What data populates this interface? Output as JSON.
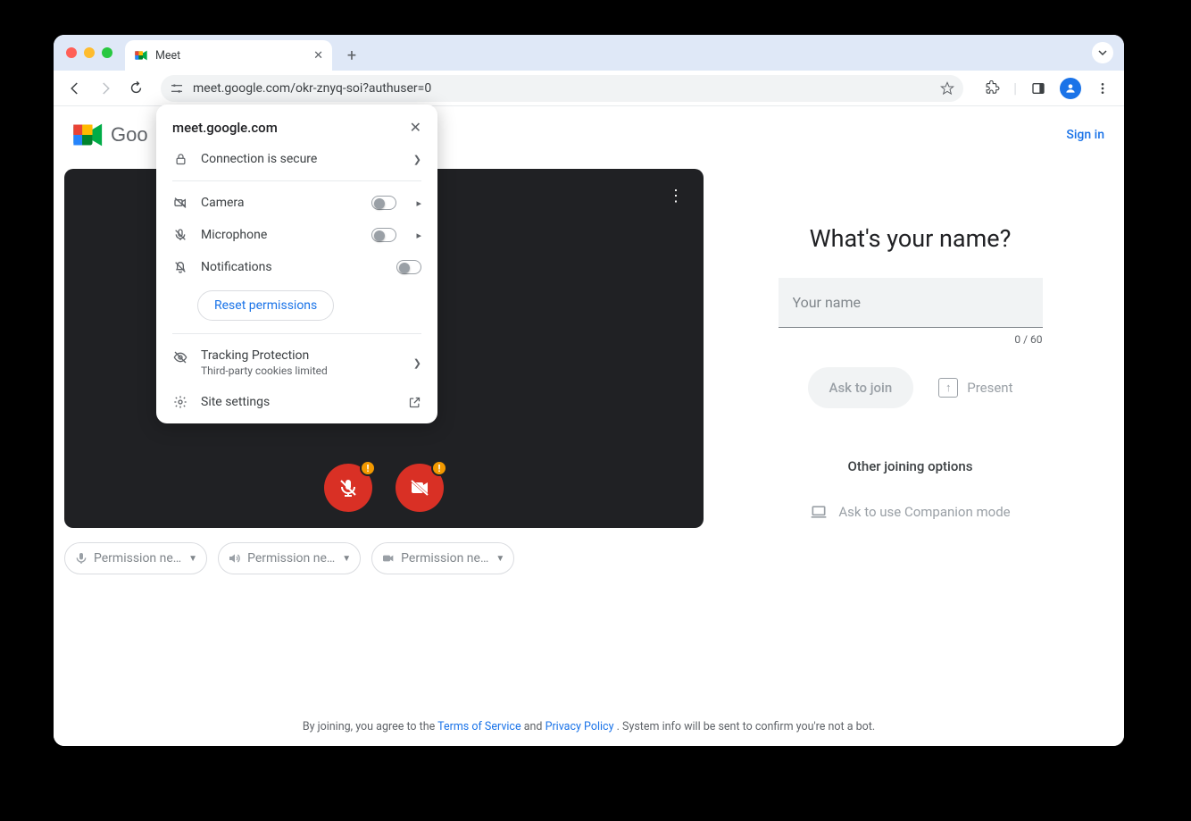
{
  "browser": {
    "tab_title": "Meet",
    "url": "meet.google.com/okr-znyq-soi?authuser=0"
  },
  "header": {
    "product": "Google Meet",
    "product_visible_prefix": "Goo",
    "signin": "Sign in"
  },
  "popover": {
    "site": "meet.google.com",
    "connection": "Connection is secure",
    "camera": "Camera",
    "microphone": "Microphone",
    "notifications": "Notifications",
    "reset": "Reset permissions",
    "tracking_title": "Tracking Protection",
    "tracking_sub": "Third-party cookies limited",
    "site_settings": "Site settings"
  },
  "preview": {
    "perm_chip_label": "Permission ne…"
  },
  "join": {
    "question": "What's your name?",
    "placeholder": "Your name",
    "value": "",
    "counter": "0 / 60",
    "ask": "Ask to join",
    "present": "Present",
    "other": "Other joining options",
    "companion": "Ask to use Companion mode"
  },
  "footer": {
    "pre": "By joining, you agree to the ",
    "tos": "Terms of Service",
    "and": " and ",
    "pp": "Privacy Policy",
    "post": ". System info will be sent to confirm you're not a bot."
  }
}
